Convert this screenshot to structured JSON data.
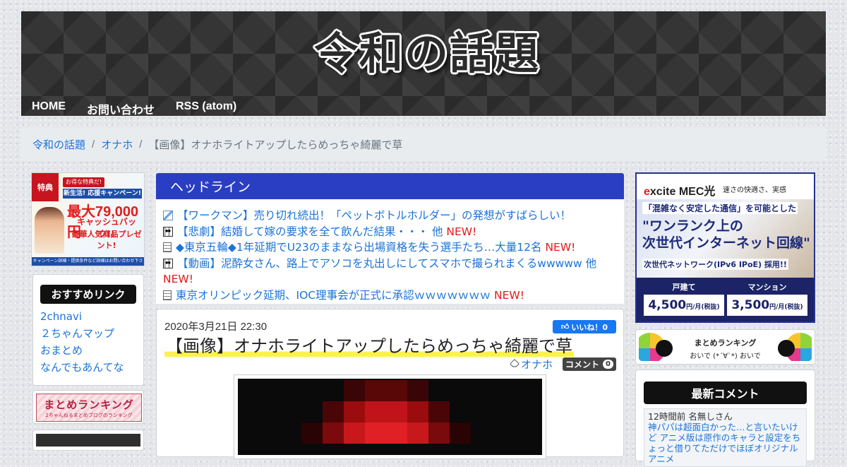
{
  "site": {
    "logo": "令和の話題"
  },
  "nav": [
    "HOME",
    "お問い合わせ",
    "RSS (atom)"
  ],
  "breadcrumb": {
    "home": "令和の話題",
    "sep": "/",
    "category": "オナホ",
    "current": "【画像】オナホライトアップしたらめっちゃ綺麗で草"
  },
  "left_ad": {
    "badge": "特典",
    "pill": "お得な特典だ!",
    "headline": "新生活! 応援キャンペーン!",
    "amount": "最大79,000円",
    "cashback": "キャッシュバック!!",
    "gift": "豪華人気商品プレゼント!",
    "footer": "キャンペーン詳細・提供条件など詳細はお問い合わせ下さい!"
  },
  "recommended": {
    "title": "おすすめリンク",
    "items": [
      "2chnavi",
      "２ちゃんマップ",
      "おまとめ",
      "なんでもあんてな"
    ]
  },
  "ranking_left": {
    "title": "まとめランキング",
    "sub": "2ちゃんねるまとめブログのランキング"
  },
  "headline": {
    "title": "ヘッドライン",
    "items": [
      {
        "icon": "feather-icon",
        "text": "【ワークマン】売り切れ続出！「ペットボトルホルダー」の発想がすばらしい！",
        "new": ""
      },
      {
        "icon": "face-icon",
        "text": "【悲劇】結婚して嫁の要求を全て飲んだ結果・・・ 他",
        "new": "NEW!"
      },
      {
        "icon": "document-icon",
        "text": "◆東京五輪◆1年延期でU23のままなら出場資格を失う選手たち…大量12名",
        "new": "NEW!"
      },
      {
        "icon": "face-icon",
        "text": "【動画】泥酔女さん、路上でアソコを丸出しにしてスマホで撮られまくるwwwww 他",
        "new": "NEW!"
      },
      {
        "icon": "document-icon",
        "text": "東京オリンピック延期、IOC理事会が正式に承認ｗｗｗｗｗｗｗ",
        "new": "NEW!"
      }
    ]
  },
  "article": {
    "date": "2020年3月21日 22:30",
    "like_label": "いいね！0",
    "title": "【画像】オナホライトアップしたらめっちゃ綺麗で草",
    "category": "オナホ",
    "comment_label": "コメント",
    "comment_count": "0"
  },
  "right_ad": {
    "brand_e": "e",
    "brand_rest": "xcite",
    "brand_product": "MEC光",
    "tagline": "速さの快適さ、実感",
    "line1": "「混雑なく安定した通信」を可能とした",
    "line2a": "\"ワンランク上の",
    "line2b": "次世代インターネット回線\"",
    "line3": "次世代ネットワーク(IPv6 IPoE) 採用!!",
    "plan1_label": "戸建て",
    "plan1_price": "4,500",
    "plan2_label": "マンション",
    "plan2_price": "3,500",
    "unit": "円/月(税抜)"
  },
  "ranking_right": {
    "title": "まとめランキング",
    "sub": "おいで (*´∀`*) おいで"
  },
  "latest_comments": {
    "title": "最新コメント",
    "meta": "12時間前 名無しさん",
    "body": "神パパは超面白かった…と言いたいけど アニメ版は原作のキャラと設定をちょっと借りてただけでほぼオリジナルアニメ"
  },
  "colors": {
    "accent_blue": "#2a3ec4",
    "link": "#1a73d9",
    "new_red": "#e21b1b",
    "highlight": "#fdf24d"
  }
}
